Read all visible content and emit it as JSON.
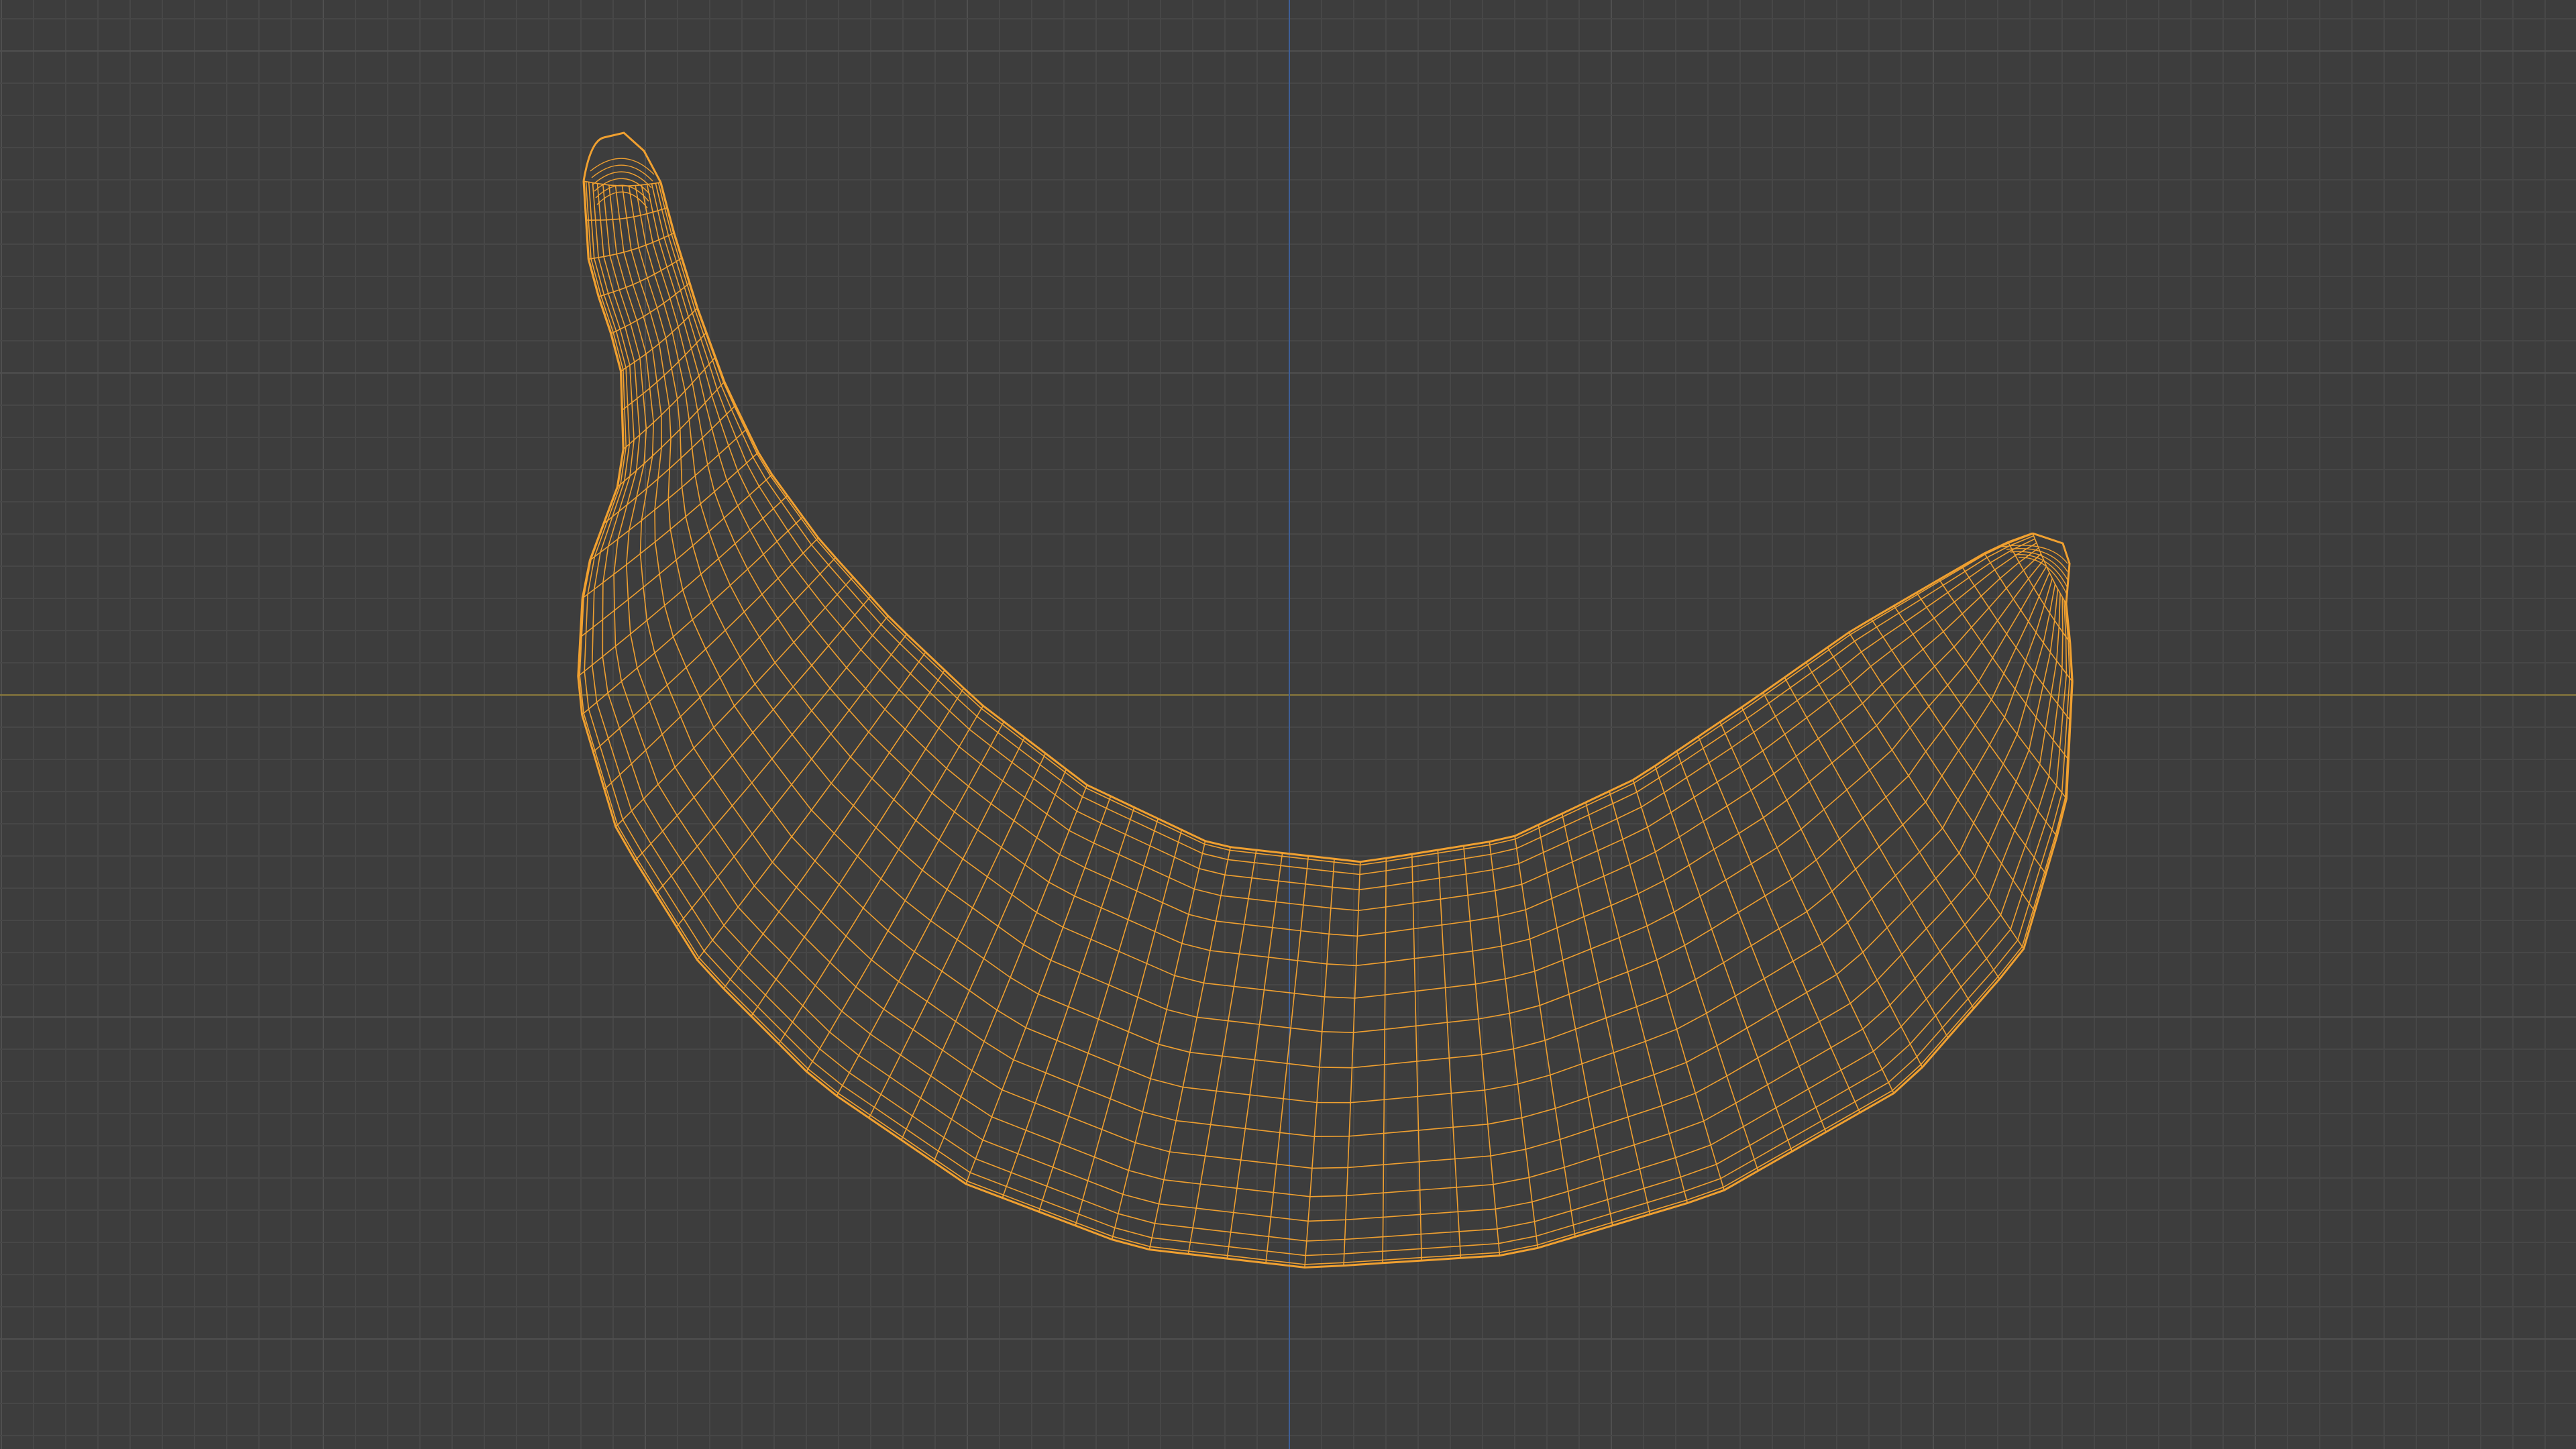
{
  "viewport": {
    "view": "front-orthographic",
    "display_mode": "wireframe",
    "grid": true,
    "colors": {
      "background": "#3d3d3d",
      "grid_minor": "#474747",
      "grid_major": "#4f4f4f",
      "axis_x": "#8a7a3c",
      "axis_z": "#3f5f96",
      "wire_selected": "#f0a030"
    }
  },
  "scene": {
    "selected_object": {
      "icon": "banana-mesh",
      "selected": true
    }
  }
}
